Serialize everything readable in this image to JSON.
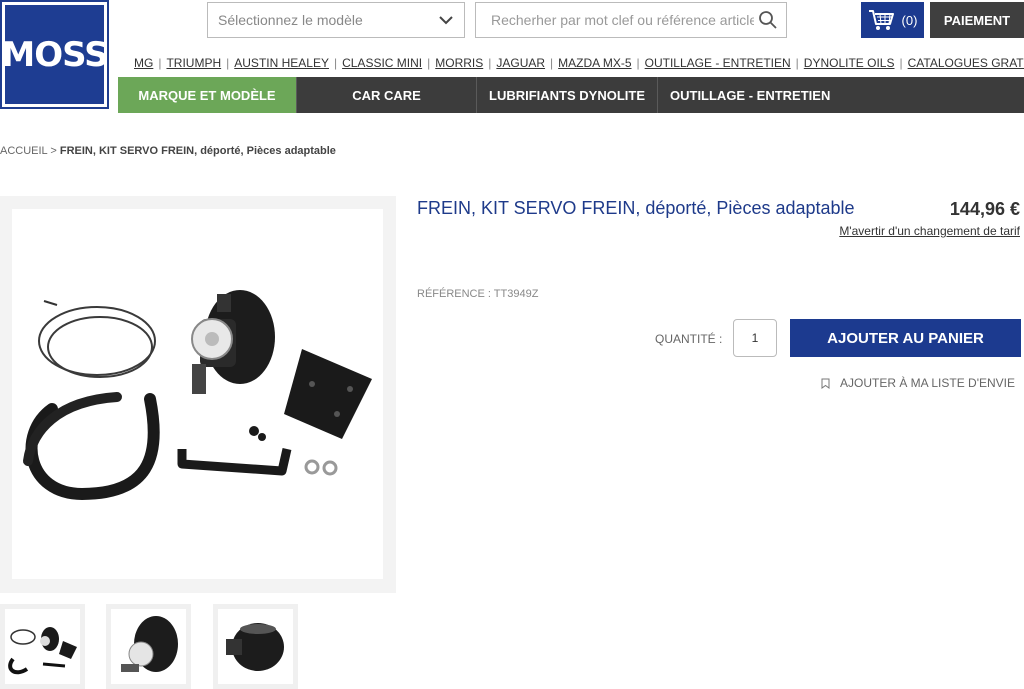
{
  "logo": {
    "text": "MOSS",
    "color": "#1e3d92"
  },
  "header": {
    "model_select": {
      "placeholder": "Sélectionnez le modèle",
      "icon": "chevron-down-icon"
    },
    "search": {
      "placeholder": "Recherher par mot clef ou référence article",
      "icon": "search-icon"
    },
    "cart": {
      "count": "(0)",
      "icon": "cart-icon"
    },
    "checkout_label": "PAIEMENT"
  },
  "brand_links": [
    "MG",
    "TRIUMPH",
    "AUSTIN HEALEY",
    "CLASSIC MINI",
    "MORRIS",
    "JAGUAR",
    "MAZDA MX-5",
    "OUTILLAGE - ENTRETIEN",
    "DYNOLITE OILS",
    "CATALOGUES GRATUITS"
  ],
  "main_nav": {
    "items": [
      {
        "label": "MARQUE ET MODÈLE",
        "active": true
      },
      {
        "label": "CAR CARE",
        "active": false
      },
      {
        "label": "LUBRIFIANTS DYNOLITE",
        "active": false
      },
      {
        "label": "OUTILLAGE - ENTRETIEN",
        "active": false
      }
    ],
    "active_color": "#6ca758"
  },
  "breadcrumb": {
    "home": "ACCUEIL",
    "separator": ">",
    "current": "FREIN, KIT SERVO FREIN, déporté, Pièces adaptable"
  },
  "product": {
    "title": "FREIN, KIT SERVO FREIN, déporté, Pièces adaptable",
    "price": "144,96 €",
    "price_alert": "M'avertir d'un changement de tarif",
    "reference": "RÉFÉRENCE : TT3949Z",
    "quantity_label": "QUANTITÉ :",
    "quantity_value": "1",
    "add_to_cart": "AJOUTER AU PANIER",
    "wishlist": "AJOUTER À MA LISTE D'ENVIE"
  },
  "colors": {
    "brand_blue": "#1c3a8f",
    "dark_nav": "#3c3c3c",
    "green": "#6ca758"
  }
}
